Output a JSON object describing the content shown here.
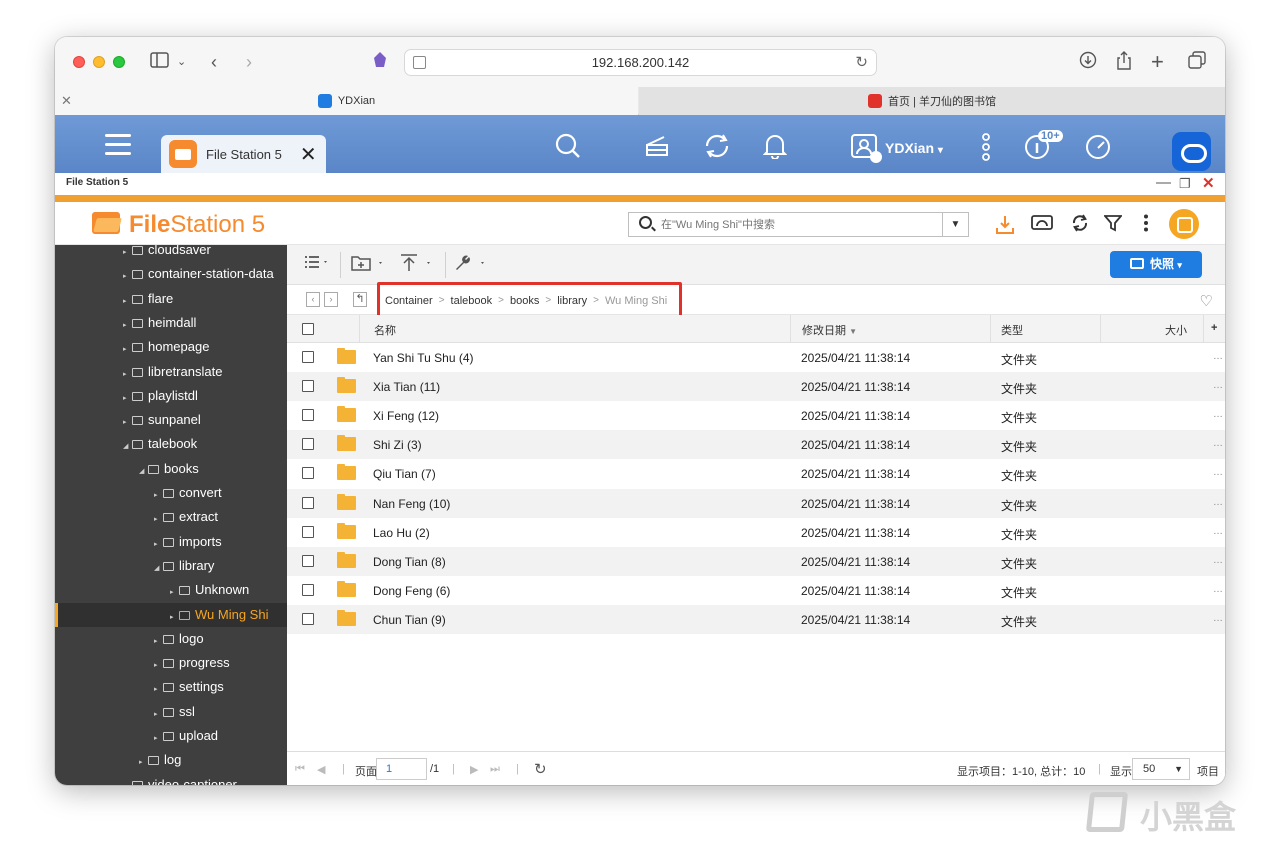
{
  "browser": {
    "url": "192.168.200.142",
    "tabs": [
      {
        "title": "YDXian"
      },
      {
        "title": "首页 | 羊刀仙的图书馆"
      }
    ]
  },
  "qts": {
    "app_tab_label": "File Station 5",
    "user": "YDXian",
    "user_caret": "▾",
    "badge": "10+"
  },
  "window": {
    "title": "File Station 5"
  },
  "app": {
    "logo_bold": "File",
    "logo_rest": "Station 5",
    "search_placeholder": "在\"Wu Ming Shi\"中搜索",
    "snapshot_button": "快照"
  },
  "sidebar": {
    "items": [
      {
        "label": "cloudsaver",
        "indent": 0
      },
      {
        "label": "container-station-data",
        "indent": 0
      },
      {
        "label": "flare",
        "indent": 0
      },
      {
        "label": "heimdall",
        "indent": 0
      },
      {
        "label": "homepage",
        "indent": 0
      },
      {
        "label": "libretranslate",
        "indent": 0
      },
      {
        "label": "playlistdl",
        "indent": 0
      },
      {
        "label": "sunpanel",
        "indent": 0
      },
      {
        "label": "talebook",
        "indent": 0,
        "expanded": true
      },
      {
        "label": "books",
        "indent": 1,
        "expanded": true
      },
      {
        "label": "convert",
        "indent": 2
      },
      {
        "label": "extract",
        "indent": 2
      },
      {
        "label": "imports",
        "indent": 2
      },
      {
        "label": "library",
        "indent": 2,
        "expanded": true
      },
      {
        "label": "Unknown",
        "indent": 3
      },
      {
        "label": "Wu Ming Shi",
        "indent": 3,
        "selected": true
      },
      {
        "label": "logo",
        "indent": 2
      },
      {
        "label": "progress",
        "indent": 2
      },
      {
        "label": "settings",
        "indent": 2
      },
      {
        "label": "ssl",
        "indent": 2
      },
      {
        "label": "upload",
        "indent": 2
      },
      {
        "label": "log",
        "indent": 1
      },
      {
        "label": "video-captioner",
        "indent": 0
      }
    ]
  },
  "breadcrumb": {
    "items": [
      "Container",
      "talebook",
      "books",
      "library",
      "Wu Ming Shi"
    ],
    "separator": ">"
  },
  "table": {
    "headers": {
      "name": "名称",
      "modified": "修改日期",
      "type": "类型",
      "size": "大小",
      "add": "+"
    },
    "rows": [
      {
        "name": "Yan Shi Tu Shu (4)",
        "modified": "2025/04/21 11:38:14",
        "type": "文件夹"
      },
      {
        "name": "Xia Tian (11)",
        "modified": "2025/04/21 11:38:14",
        "type": "文件夹"
      },
      {
        "name": "Xi Feng (12)",
        "modified": "2025/04/21 11:38:14",
        "type": "文件夹"
      },
      {
        "name": "Shi Zi (3)",
        "modified": "2025/04/21 11:38:14",
        "type": "文件夹"
      },
      {
        "name": "Qiu Tian (7)",
        "modified": "2025/04/21 11:38:14",
        "type": "文件夹"
      },
      {
        "name": "Nan Feng (10)",
        "modified": "2025/04/21 11:38:14",
        "type": "文件夹"
      },
      {
        "name": "Lao Hu (2)",
        "modified": "2025/04/21 11:38:14",
        "type": "文件夹"
      },
      {
        "name": "Dong Tian (8)",
        "modified": "2025/04/21 11:38:14",
        "type": "文件夹"
      },
      {
        "name": "Dong Feng (6)",
        "modified": "2025/04/21 11:38:14",
        "type": "文件夹"
      },
      {
        "name": "Chun Tian (9)",
        "modified": "2025/04/21 11:38:14",
        "type": "文件夹"
      }
    ]
  },
  "footer": {
    "page_label": "页面",
    "page_value": "1",
    "page_total": "/1",
    "display_items": "显示项目：1-10, 总计：10",
    "show_label": "显示",
    "per_page": "50",
    "items_label": "项目"
  },
  "watermark": "小黑盒",
  "colors": {
    "accent_orange": "#f58a2e",
    "header_blue": "#5a86c8",
    "snapshot_blue": "#1f7ce0",
    "highlight_red": "#e0322a"
  }
}
